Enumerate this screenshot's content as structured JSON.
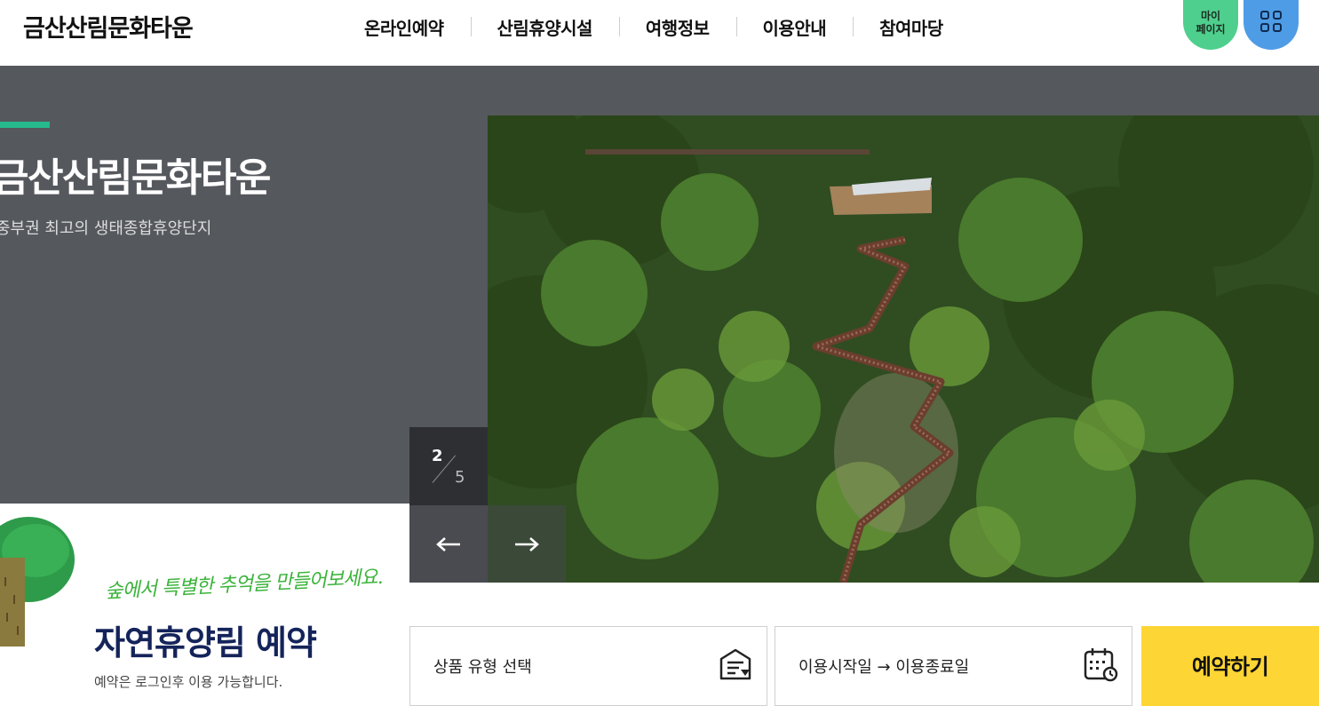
{
  "header": {
    "logo": "금산산림문화타운",
    "nav": [
      "온라인예약",
      "산림휴양시설",
      "여행정보",
      "이용안내",
      "참여마당"
    ],
    "mypage_line1": "마이",
    "mypage_line2": "페이지",
    "allmenu_icon": "grid-icon"
  },
  "hero": {
    "title": "금산산림문화타운",
    "subtitle": "중부권 최고의 생태종합휴양단지",
    "counter_current": "2",
    "counter_total": "5",
    "prev_icon": "arrow-left-icon",
    "next_icon": "arrow-right-icon",
    "colors": {
      "accent": "#26b98b",
      "background": "#55585d"
    }
  },
  "reservation": {
    "slogan": "숲에서 특별한 추억을 만들어보세요.",
    "title": "자연휴양림 예약",
    "note": "예약은 로그인후 이용 가능합니다.",
    "type_select": "상품 유형 선택",
    "date_range": "이용시작일 → 이용종료일",
    "submit": "예약하기",
    "colors": {
      "submit_bg": "#fdd535",
      "title": "#14245a",
      "slogan": "#3bb33b"
    }
  }
}
